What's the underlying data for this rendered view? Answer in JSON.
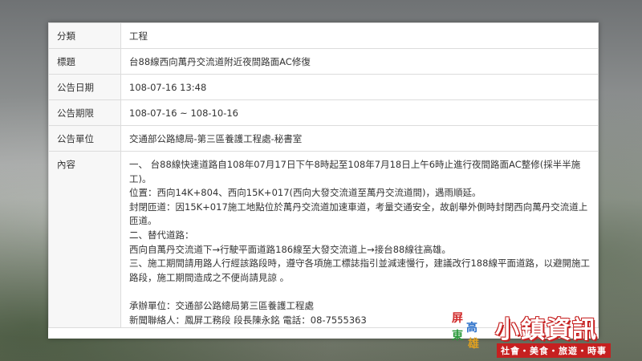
{
  "rows": [
    {
      "label": "分類",
      "value": "工程"
    },
    {
      "label": "標題",
      "value": "台88線西向萬丹交流道附近夜間路面AC修復"
    },
    {
      "label": "公告日期",
      "value": "108-07-16 13:48"
    },
    {
      "label": "公告期限",
      "value": "108-07-16 ~ 108-10-16"
    },
    {
      "label": "公告單位",
      "value": "交通部公路總局-第三區養護工程處-秘書室"
    }
  ],
  "content": {
    "label": "內容",
    "lines": [
      "一、 台88線快速道路自108年07月17日下午8時起至108年7月18日上午6時止進行夜間路面AC整修(採半半施工)。",
      "位置：西向14K+804、西向15K+017(西向大發交流道至萬丹交流道間)，遇雨順延。",
      "封閉匝道：因15K+017施工地點位於萬丹交流道加速車道，考量交通安全，故創舉外側時封閉西向萬丹交流道上匝道。",
      "二、替代道路：",
      "西向自萬丹交流道下→行駛平面道路186線至大發交流道上→接台88線往高雄。",
      "三、施工期間請用路人行經該路段時，遵守各項施工標誌指引並減速慢行，建議改行188線平面道路，以避開施工路段，施工期間造成之不便尚請見諒 。",
      "",
      "承辦單位：交通部公路總局第三區養護工程處",
      "新聞聯絡人：鳳屏工務段 段長陳永銘 電話：08-7555363"
    ]
  },
  "logo": {
    "badge_chars": [
      "屏",
      "高",
      "東",
      "雄"
    ],
    "title": "小鎮資訊",
    "subtitle": "社會・美食・旅遊・時事"
  }
}
